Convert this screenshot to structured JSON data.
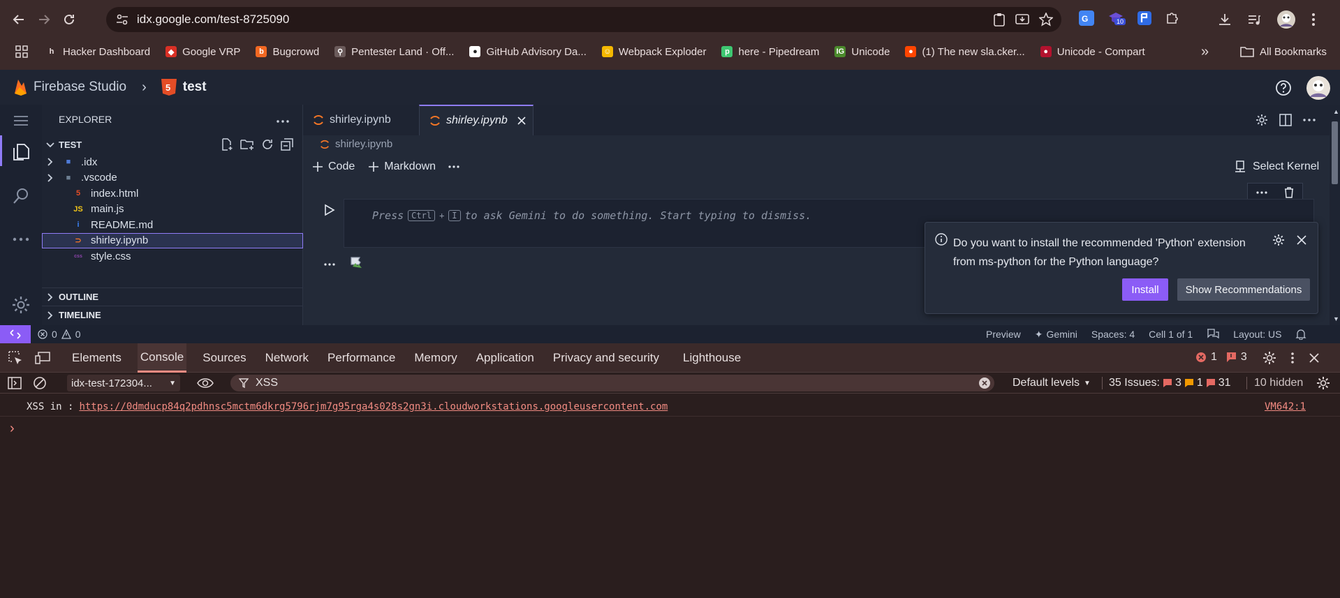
{
  "browser": {
    "url": "idx.google.com/test-8725090",
    "extension_badge": "10",
    "bookmarks": [
      {
        "label": "Hacker Dashboard",
        "icon": "h-icon",
        "color": "#3b2a2a",
        "glyph": "h"
      },
      {
        "label": "Google VRP",
        "icon": "vrp-icon",
        "color": "#d93025",
        "glyph": "◆"
      },
      {
        "label": "Bugcrowd",
        "icon": "bugcrowd-icon",
        "color": "#f26822",
        "glyph": "b"
      },
      {
        "label": "Pentester Land · Off...",
        "icon": "pentester-icon",
        "color": "#6b5b5b",
        "glyph": "⚲"
      },
      {
        "label": "GitHub Advisory Da...",
        "icon": "github-icon",
        "color": "#ffffff",
        "glyph": "●"
      },
      {
        "label": "Webpack Exploder",
        "icon": "webpack-icon",
        "color": "#f5b800",
        "glyph": "☺"
      },
      {
        "label": "here - Pipedream",
        "icon": "pipedream-icon",
        "color": "#3ec771",
        "glyph": "p"
      },
      {
        "label": "Unicode",
        "icon": "unicode-icon",
        "color": "#4b8a2c",
        "glyph": "IG"
      },
      {
        "label": "(1) The new sla.cker...",
        "icon": "reddit-icon",
        "color": "#ff4500",
        "glyph": "●"
      },
      {
        "label": "Unicode - Compart",
        "icon": "compart-icon",
        "color": "#b3122e",
        "glyph": "●"
      }
    ],
    "all_bookmarks": "All Bookmarks"
  },
  "ide": {
    "brand": "Firebase Studio",
    "project": "test",
    "explorer_title": "EXPLORER",
    "root": "TEST",
    "files": [
      {
        "name": ".idx",
        "kind": "folder",
        "icon": "idx-folder-icon",
        "color": "#4f7bd8",
        "glyph": "■"
      },
      {
        "name": ".vscode",
        "kind": "folder",
        "icon": "vscode-folder-icon",
        "color": "#6d7f93",
        "glyph": "■"
      },
      {
        "name": "index.html",
        "kind": "file",
        "icon": "html-file-icon",
        "color": "#e44d26",
        "glyph": "5"
      },
      {
        "name": "main.js",
        "kind": "file",
        "icon": "js-file-icon",
        "color": "#f0c419",
        "glyph": "JS"
      },
      {
        "name": "README.md",
        "kind": "file",
        "icon": "info-file-icon",
        "color": "#3b82f6",
        "glyph": "i"
      },
      {
        "name": "shirley.ipynb",
        "kind": "file",
        "icon": "jupyter-file-icon",
        "color": "#f37626",
        "glyph": "⊃",
        "selected": true
      },
      {
        "name": "style.css",
        "kind": "file",
        "icon": "css-file-icon",
        "color": "#8e44ad",
        "glyph": "css"
      }
    ],
    "sections": [
      "OUTLINE",
      "TIMELINE"
    ],
    "tabs": [
      {
        "label": "shirley.ipynb",
        "active": false
      },
      {
        "label": "shirley.ipynb",
        "active": true
      }
    ],
    "breadcrumb": "shirley.ipynb",
    "toolbar": {
      "code": "Code",
      "markdown": "Markdown",
      "select_kernel": "Select Kernel"
    },
    "cell_hint": {
      "press": "Press",
      "key1": "Ctrl",
      "plus": "+",
      "key2": "I",
      "rest": "to ask Gemini to do something. Start typing to dismiss."
    },
    "notification": {
      "message_line1": "Do you want to install the recommended 'Python' extension",
      "message_line2": "from ms-python for the Python language?",
      "install": "Install",
      "show_recommendations": "Show Recommendations"
    },
    "status": {
      "preview": "Preview",
      "gemini": "Gemini",
      "spaces": "Spaces: 4",
      "cell": "Cell 1 of 1",
      "layout": "Layout: US",
      "errors": "0",
      "warnings": "0"
    }
  },
  "devtools": {
    "tabs": [
      "Elements",
      "Console",
      "Sources",
      "Network",
      "Performance",
      "Memory",
      "Application",
      "Privacy and security",
      "Lighthouse"
    ],
    "active_tab": "Console",
    "error_count": "1",
    "issue_count": "3",
    "context": "idx-test-172304...",
    "filter": "XSS",
    "levels": "Default levels",
    "issues_label": "35 Issues:",
    "issues_errors": "3",
    "issues_warnings": "1",
    "issues_info": "31",
    "hidden": "10 hidden",
    "log": {
      "prefix": "XSS in :",
      "link": "https://0dmducp84q2pdhnsc5mctm6dkrg5796rjm7g95rga4s028s2gn3i.cloudworkstations.googleusercontent.com",
      "source": "VM642:1"
    },
    "prompt": "›"
  }
}
